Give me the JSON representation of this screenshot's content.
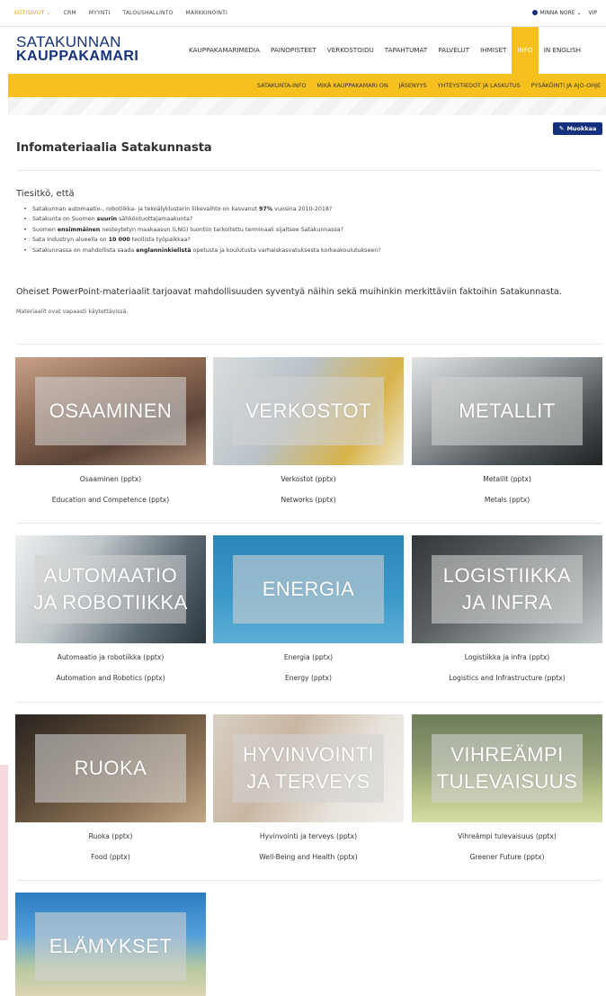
{
  "topbar": {
    "links": [
      "KOTISIVUT ⌄",
      "CRM",
      "MYYNTI",
      "TALOUSHALLINTO",
      "MARKKINOINTI"
    ],
    "user": "MINNA NORE ⌄",
    "vip": "VIP"
  },
  "logo": {
    "line1": "SATAKUNNAN",
    "line2": "KAUPPAKAMARI"
  },
  "mainnav": [
    "KAUPPAKAMARIMEDIA",
    "PAINOPISTEET",
    "VERKOSTOIDU",
    "TAPAHTUMAT",
    "PALVELUT",
    "IHMISET",
    "INFO",
    "IN ENGLISH"
  ],
  "subnav": [
    "SATAKUNTA-INFO",
    "MIKÄ KAUPPAKAMARI ON",
    "JÄSENYYS",
    "YHTEYSTIEDOT JA LASKUTUS",
    "PYSÄKÖINTI JA AJO-OHJE"
  ],
  "edit_label": "Muokkaa",
  "title": "Infomateriaalia Satakunnasta",
  "facts_title": "Tiesitkö, että",
  "facts": [
    [
      "Satakunnan automaatio-, robotiikka- ja tekoälyklusterin liikevaihto on kasvanut ",
      "97%",
      " vuosina 2010-2018?"
    ],
    [
      "Satakunta on Suomen ",
      "suurin",
      " sähköntuottajamaakunta?"
    ],
    [
      "Suomen ",
      "ensimmäinen",
      " nesteytetyn maakaasun (LNG) tuontiin tarkoitettu terminaali sijaitsee Satakunnassa?"
    ],
    [
      "Sata Industryn alueella on ",
      "10 000",
      " teollista työpaikkaa?"
    ],
    [
      "Satakunnassa on mahdollista saada ",
      "englanninkielistä",
      " opetusta ja koulutusta varhaiskasvatuksesta korkeakoulutukseen?"
    ]
  ],
  "intro": "Oheiset PowerPoint-materiaalit tarjoavat mahdollisuuden syventyä näihin sekä muihinkin merkittäviin faktoihin Satakunnasta.",
  "note": "Materiaalit ovat vapaasti käytettävissä.",
  "tiles": [
    {
      "label": "OSAAMINEN",
      "fi": "Osaaminen (pptx)",
      "en": "Education and Competence (pptx)"
    },
    {
      "label": "VERKOSTOT",
      "fi": "Verkostot (pptx)",
      "en": "Networks (pptx)"
    },
    {
      "label": "METALLIT",
      "fi": "Metallit (pptx)",
      "en": "Metals (pptx)"
    },
    {
      "label": "AUTOMAATIO\nJA ROBOTIIKKA",
      "fi": "Automaatio ja robotiikka (pptx)",
      "en": "Automation and Robotics (pptx)"
    },
    {
      "label": "ENERGIA",
      "fi": "Energia (pptx)",
      "en": "Energy (pptx)"
    },
    {
      "label": "LOGISTIIKKA\nJA INFRA",
      "fi": "Logistiikka ja infra (pptx)",
      "en": "Logistics and Infrastructure (pptx)"
    },
    {
      "label": "RUOKA",
      "fi": "Ruoka (pptx)",
      "en": "Food (pptx)"
    },
    {
      "label": "HYVINVOINTI\nJA TERVEYS",
      "fi": "Hyvinvointi ja terveys (pptx)",
      "en": "Well-Being and Health (pptx)"
    },
    {
      "label": "VIHREÄMPI\nTULEVAISUUS",
      "fi": "Vihreämpi tulevaisuus (pptx)",
      "en": "Greener Future (pptx)"
    },
    {
      "label": "ELÄMYKSET"
    }
  ]
}
